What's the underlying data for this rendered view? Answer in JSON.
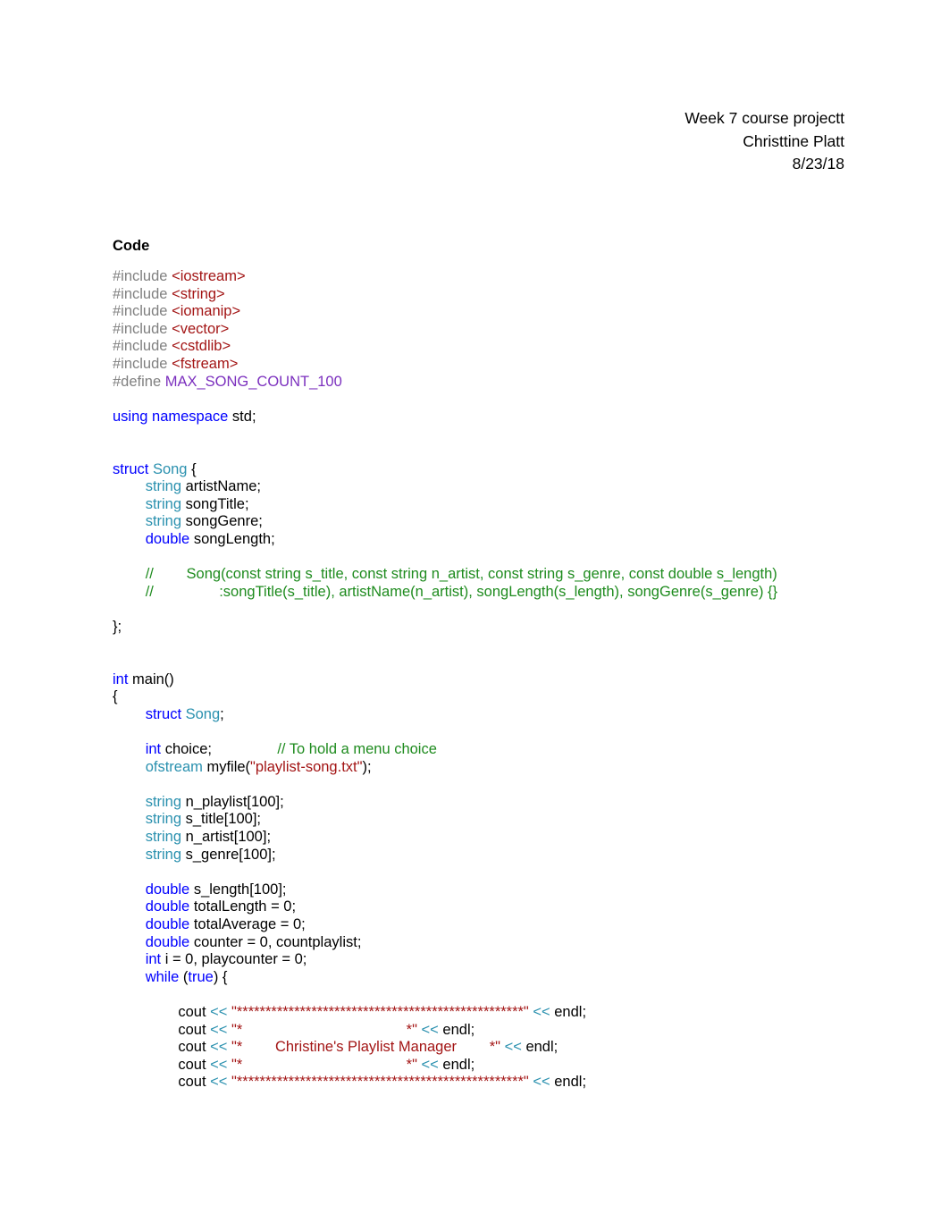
{
  "header": {
    "line1": "Week 7 course projectt",
    "line2": "Christtine Platt",
    "line3": "8/23/18"
  },
  "section": {
    "heading": "Code"
  },
  "colors": {
    "preprocessor": "#808080",
    "header_literal": "#a31515",
    "macro": "#7b2fbe",
    "keyword": "#0000ff",
    "type": "#2b91af",
    "comment": "#1e8b1e",
    "plain": "#000000",
    "background": "#ffffff"
  },
  "code": {
    "lines": [
      {
        "id": "l1",
        "tokens": [
          {
            "t": "#include ",
            "c": "pre"
          },
          {
            "t": "<iostream>",
            "c": "hdr"
          }
        ]
      },
      {
        "id": "l2",
        "tokens": [
          {
            "t": "#include ",
            "c": "pre"
          },
          {
            "t": "<string>",
            "c": "hdr"
          }
        ]
      },
      {
        "id": "l3",
        "tokens": [
          {
            "t": "#include ",
            "c": "pre"
          },
          {
            "t": "<iomanip>",
            "c": "hdr"
          }
        ]
      },
      {
        "id": "l4",
        "tokens": [
          {
            "t": "#include ",
            "c": "pre"
          },
          {
            "t": "<vector>",
            "c": "hdr"
          }
        ]
      },
      {
        "id": "l5",
        "tokens": [
          {
            "t": "#include ",
            "c": "pre"
          },
          {
            "t": "<cstdlib>",
            "c": "hdr"
          }
        ]
      },
      {
        "id": "l6",
        "tokens": [
          {
            "t": "#include ",
            "c": "pre"
          },
          {
            "t": "<fstream>",
            "c": "hdr"
          }
        ]
      },
      {
        "id": "l7",
        "tokens": [
          {
            "t": "#define ",
            "c": "pre"
          },
          {
            "t": "MAX_SONG_COUNT_100",
            "c": "macro"
          }
        ]
      },
      {
        "id": "l8",
        "tokens": []
      },
      {
        "id": "l9",
        "tokens": [
          {
            "t": "using namespace",
            "c": "kw"
          },
          {
            "t": " std;",
            "c": "plain"
          }
        ]
      },
      {
        "id": "l10",
        "tokens": []
      },
      {
        "id": "l11",
        "tokens": []
      },
      {
        "id": "l12",
        "tokens": [
          {
            "t": "struct ",
            "c": "kw"
          },
          {
            "t": "Song",
            "c": "type"
          },
          {
            "t": " {",
            "c": "plain"
          }
        ]
      },
      {
        "id": "l13",
        "tokens": [
          {
            "t": "\t",
            "c": "plain"
          },
          {
            "t": "string",
            "c": "type"
          },
          {
            "t": " artistName;",
            "c": "plain"
          }
        ]
      },
      {
        "id": "l14",
        "tokens": [
          {
            "t": "\t",
            "c": "plain"
          },
          {
            "t": "string",
            "c": "type"
          },
          {
            "t": " songTitle;",
            "c": "plain"
          }
        ]
      },
      {
        "id": "l15",
        "tokens": [
          {
            "t": "\t",
            "c": "plain"
          },
          {
            "t": "string",
            "c": "type"
          },
          {
            "t": " songGenre;",
            "c": "plain"
          }
        ]
      },
      {
        "id": "l16",
        "tokens": [
          {
            "t": "\t",
            "c": "plain"
          },
          {
            "t": "double",
            "c": "kw"
          },
          {
            "t": " songLength;",
            "c": "plain"
          }
        ]
      },
      {
        "id": "l17",
        "tokens": []
      },
      {
        "id": "l18",
        "tokens": [
          {
            "t": "\t//\tSong(const string s_title, const string n_artist, const string s_genre, const double s_length)",
            "c": "cmt"
          }
        ]
      },
      {
        "id": "l19",
        "tokens": [
          {
            "t": "\t//\t\t:songTitle(s_title), artistName(n_artist), songLength(s_length), songGenre(s_genre) {}",
            "c": "cmt"
          }
        ]
      },
      {
        "id": "l20",
        "tokens": []
      },
      {
        "id": "l21",
        "tokens": [
          {
            "t": "};",
            "c": "plain"
          }
        ]
      },
      {
        "id": "l22",
        "tokens": []
      },
      {
        "id": "l23",
        "tokens": []
      },
      {
        "id": "l24",
        "tokens": [
          {
            "t": "int",
            "c": "kw"
          },
          {
            "t": " main()",
            "c": "plain"
          }
        ]
      },
      {
        "id": "l25",
        "tokens": [
          {
            "t": "{",
            "c": "plain"
          }
        ]
      },
      {
        "id": "l26",
        "tokens": [
          {
            "t": "\t",
            "c": "plain"
          },
          {
            "t": "struct ",
            "c": "kw"
          },
          {
            "t": "Song",
            "c": "type"
          },
          {
            "t": ";",
            "c": "plain"
          }
        ]
      },
      {
        "id": "l27",
        "tokens": []
      },
      {
        "id": "l28",
        "tokens": [
          {
            "t": "\t",
            "c": "plain"
          },
          {
            "t": "int",
            "c": "kw"
          },
          {
            "t": " choice;\t\t",
            "c": "plain"
          },
          {
            "t": "// To hold a menu choice",
            "c": "cmt"
          }
        ]
      },
      {
        "id": "l29",
        "tokens": [
          {
            "t": "\t",
            "c": "plain"
          },
          {
            "t": "ofstream",
            "c": "type"
          },
          {
            "t": " myfile(",
            "c": "plain"
          },
          {
            "t": "\"playlist-song.txt\"",
            "c": "hdr"
          },
          {
            "t": ");",
            "c": "plain"
          }
        ]
      },
      {
        "id": "l30",
        "tokens": []
      },
      {
        "id": "l31",
        "tokens": [
          {
            "t": "\t",
            "c": "plain"
          },
          {
            "t": "string",
            "c": "type"
          },
          {
            "t": " n_playlist[100];",
            "c": "plain"
          }
        ]
      },
      {
        "id": "l32",
        "tokens": [
          {
            "t": "\t",
            "c": "plain"
          },
          {
            "t": "string",
            "c": "type"
          },
          {
            "t": " s_title[100];",
            "c": "plain"
          }
        ]
      },
      {
        "id": "l33",
        "tokens": [
          {
            "t": "\t",
            "c": "plain"
          },
          {
            "t": "string",
            "c": "type"
          },
          {
            "t": " n_artist[100];",
            "c": "plain"
          }
        ]
      },
      {
        "id": "l34",
        "tokens": [
          {
            "t": "\t",
            "c": "plain"
          },
          {
            "t": "string",
            "c": "type"
          },
          {
            "t": " s_genre[100];",
            "c": "plain"
          }
        ]
      },
      {
        "id": "l35",
        "tokens": []
      },
      {
        "id": "l36",
        "tokens": [
          {
            "t": "\t",
            "c": "plain"
          },
          {
            "t": "double",
            "c": "kw"
          },
          {
            "t": " s_length[100];",
            "c": "plain"
          }
        ]
      },
      {
        "id": "l37",
        "tokens": [
          {
            "t": "\t",
            "c": "plain"
          },
          {
            "t": "double",
            "c": "kw"
          },
          {
            "t": " totalLength = 0;",
            "c": "plain"
          }
        ]
      },
      {
        "id": "l38",
        "tokens": [
          {
            "t": "\t",
            "c": "plain"
          },
          {
            "t": "double",
            "c": "kw"
          },
          {
            "t": " totalAverage = 0;",
            "c": "plain"
          }
        ]
      },
      {
        "id": "l39",
        "tokens": [
          {
            "t": "\t",
            "c": "plain"
          },
          {
            "t": "double",
            "c": "kw"
          },
          {
            "t": " counter = 0, countplaylist;",
            "c": "plain"
          }
        ]
      },
      {
        "id": "l40",
        "tokens": [
          {
            "t": "\t",
            "c": "plain"
          },
          {
            "t": "int",
            "c": "kw"
          },
          {
            "t": " i = 0, playcounter = 0;",
            "c": "plain"
          }
        ]
      },
      {
        "id": "l41",
        "tokens": [
          {
            "t": "\t",
            "c": "plain"
          },
          {
            "t": "while",
            "c": "kw"
          },
          {
            "t": " (",
            "c": "plain"
          },
          {
            "t": "true",
            "c": "kw"
          },
          {
            "t": ") {",
            "c": "plain"
          }
        ]
      },
      {
        "id": "l42",
        "tokens": []
      },
      {
        "id": "l43",
        "tokens": [
          {
            "t": "\t\tcout ",
            "c": "plain"
          },
          {
            "t": "<<",
            "c": "type"
          },
          {
            "t": " ",
            "c": "plain"
          },
          {
            "t": "\"**************************************************\"",
            "c": "hdr"
          },
          {
            "t": " ",
            "c": "plain"
          },
          {
            "t": "<<",
            "c": "type"
          },
          {
            "t": " endl;",
            "c": "plain"
          }
        ]
      },
      {
        "id": "l44",
        "tokens": [
          {
            "t": "\t\tcout ",
            "c": "plain"
          },
          {
            "t": "<<",
            "c": "type"
          },
          {
            "t": " ",
            "c": "plain"
          },
          {
            "t": "\"*                                        *\"",
            "c": "hdr"
          },
          {
            "t": " ",
            "c": "plain"
          },
          {
            "t": "<<",
            "c": "type"
          },
          {
            "t": " endl;",
            "c": "plain"
          }
        ]
      },
      {
        "id": "l45",
        "tokens": [
          {
            "t": "\t\tcout ",
            "c": "plain"
          },
          {
            "t": "<<",
            "c": "type"
          },
          {
            "t": " ",
            "c": "plain"
          },
          {
            "t": "\"*        Christine's Playlist Manager        *\"",
            "c": "hdr"
          },
          {
            "t": " ",
            "c": "plain"
          },
          {
            "t": "<<",
            "c": "type"
          },
          {
            "t": " endl;",
            "c": "plain"
          }
        ]
      },
      {
        "id": "l46",
        "tokens": [
          {
            "t": "\t\tcout ",
            "c": "plain"
          },
          {
            "t": "<<",
            "c": "type"
          },
          {
            "t": " ",
            "c": "plain"
          },
          {
            "t": "\"*                                        *\"",
            "c": "hdr"
          },
          {
            "t": " ",
            "c": "plain"
          },
          {
            "t": "<<",
            "c": "type"
          },
          {
            "t": " endl;",
            "c": "plain"
          }
        ]
      },
      {
        "id": "l47",
        "tokens": [
          {
            "t": "\t\tcout ",
            "c": "plain"
          },
          {
            "t": "<<",
            "c": "type"
          },
          {
            "t": " ",
            "c": "plain"
          },
          {
            "t": "\"**************************************************\"",
            "c": "hdr"
          },
          {
            "t": " ",
            "c": "plain"
          },
          {
            "t": "<<",
            "c": "type"
          },
          {
            "t": " endl;",
            "c": "plain"
          }
        ]
      }
    ]
  }
}
